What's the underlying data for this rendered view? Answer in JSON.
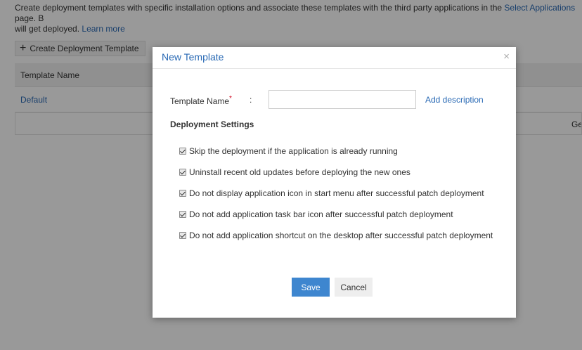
{
  "background": {
    "intro_text": "Create deployment templates with specific installation options and associate these templates with the third party applications in the",
    "intro_link": "Select Applications",
    "intro_text2": "page. B",
    "intro_line2": "will get deployed.",
    "learn_more": "Learn more",
    "create_button": "Create Deployment Template",
    "column_header": "Template Name",
    "row_default": "Default",
    "row2_trailing": "Ge"
  },
  "modal": {
    "title": "New Template",
    "close_symbol": "×",
    "name_label": "Template Name",
    "required_marker": "*",
    "colon": ":",
    "name_value": "",
    "add_description": "Add description",
    "section_title": "Deployment Settings",
    "options": [
      {
        "label": "Skip the deployment if the application is already running",
        "checked": true
      },
      {
        "label": "Uninstall recent old updates before deploying the new ones",
        "checked": true
      },
      {
        "label": "Do not display application icon in start menu after successful patch deployment",
        "checked": true
      },
      {
        "label": "Do not add application task bar icon after successful patch deployment",
        "checked": true
      },
      {
        "label": "Do not add application shortcut on the desktop after successful patch deployment",
        "checked": true
      }
    ],
    "save_label": "Save",
    "cancel_label": "Cancel"
  },
  "colors": {
    "link": "#2a6ab5",
    "primary_button": "#3e86cf",
    "required": "#d0021b"
  }
}
